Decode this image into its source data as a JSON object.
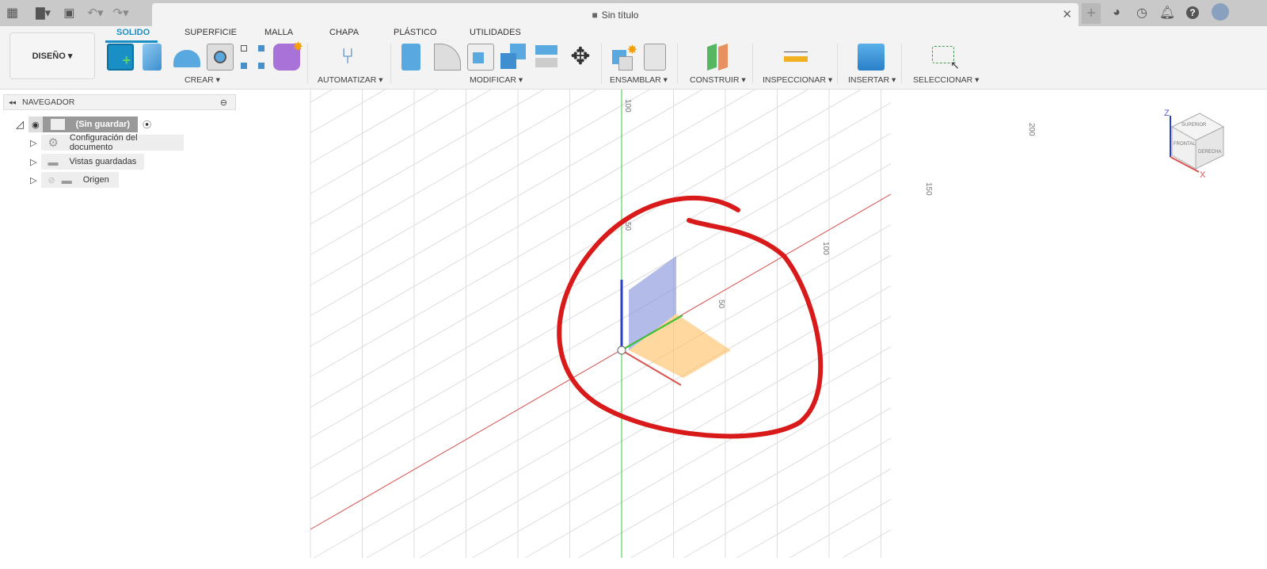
{
  "window": {
    "title": "Sin título"
  },
  "colors": {
    "accent": "#1a8fc6",
    "x_axis": "#d9534f",
    "y_axis": "#37c837",
    "z_axis": "#2b3fc4",
    "annotation": "#d91a1a"
  },
  "quick_access": {
    "icons": [
      "apps-grid-icon",
      "file-icon",
      "save-icon",
      "undo-icon",
      "redo-icon"
    ]
  },
  "right_icons": [
    "new-tab-icon",
    "extensions-icon",
    "job-status-icon",
    "notifications-icon",
    "help-icon",
    "user-avatar-icon"
  ],
  "workspace": {
    "label": "DISEÑO ▾"
  },
  "ribbon": {
    "tabs": [
      "SOLIDO",
      "SUPERFICIE",
      "MALLA",
      "CHAPA",
      "PLÁSTICO",
      "UTILIDADES"
    ],
    "active_tab": "SOLIDO",
    "groups": [
      "CREAR ▾",
      "AUTOMATIZAR ▾",
      "MODIFICAR ▾",
      "ENSAMBLAR ▾",
      "CONSTRUIR ▾",
      "INSPECCIONAR ▾",
      "INSERTAR ▾",
      "SELECCIONAR ▾"
    ]
  },
  "navigator": {
    "title": "NAVEGADOR",
    "root": "(Sin guardar)",
    "items": [
      "Configuración del documento",
      "Vistas guardadas",
      "Origen"
    ]
  },
  "viewport": {
    "grid_labels": [
      "100",
      "200",
      "150",
      "100",
      "50",
      "50"
    ],
    "viewcube": {
      "top": "SUPERIOR",
      "front": "FRONTAL",
      "right": "DERECHA",
      "z": "Z",
      "x": "X"
    }
  }
}
